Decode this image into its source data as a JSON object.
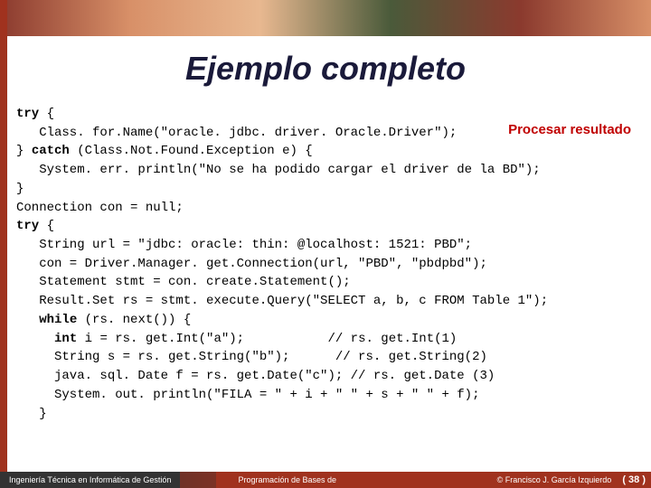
{
  "title": "Ejemplo completo",
  "annotation": "Procesar resultado",
  "code": {
    "l01a": "try",
    "l01b": " {",
    "l02": "   Class. for.Name(\"oracle. jdbc. driver. Oracle.Driver\");",
    "l03a": "} ",
    "l03b": "catch",
    "l03c": " (Class.Not.Found.Exception e) {",
    "l04": "   System. err. println(\"No se ha podido cargar el driver de la BD\");",
    "l05": "}",
    "l06": "Connection con = null;",
    "l07a": "try",
    "l07b": " {",
    "l08": "   String url = \"jdbc: oracle: thin: @localhost: 1521: PBD\";",
    "l09": "   con = Driver.Manager. get.Connection(url, \"PBD\", \"pbdpbd\");",
    "l10": "   Statement stmt = con. create.Statement();",
    "l11": "   Result.Set rs = stmt. execute.Query(\"SELECT a, b, c FROM Table 1\");",
    "l12a": "   ",
    "l12b": "while",
    "l12c": " (rs. next()) {",
    "l13a": "     ",
    "l13b": "int",
    "l13c": " i = rs. get.Int(\"a\");           // rs. get.Int(1)",
    "l14": "     String s = rs. get.String(\"b\");      // rs. get.String(2)",
    "l15": "     java. sql. Date f = rs. get.Date(\"c\"); // rs. get.Date (3)",
    "l16": "     System. out. println(\"FILA = \" + i + \" \" + s + \" \" + f);",
    "l17": "   }"
  },
  "footer": {
    "left": "Ingeniería Técnica en Informática de Gestión",
    "center": "Programación de Bases de",
    "right": "© Francisco J. García Izquierdo",
    "page": "( 38 )"
  }
}
